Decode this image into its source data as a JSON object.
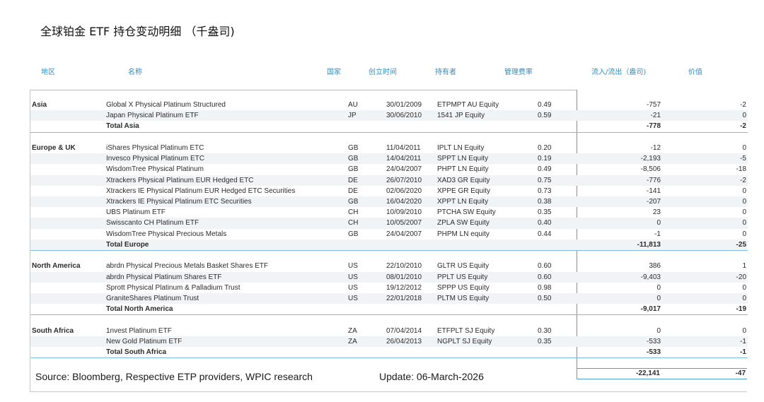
{
  "title": "全球铂金 ETF 持仓变动明细 （千盎司)",
  "headers": {
    "region": "地区",
    "name": "名称",
    "country": "国家",
    "date": "创立时间",
    "holder": "持有者",
    "fee": "管理费率",
    "flow": "流入/流出（盎司)",
    "value": "价值"
  },
  "sections": [
    {
      "region": "Asia",
      "rows": [
        {
          "name": "Global X Physical Platinum Structured",
          "country": "AU",
          "date": "30/01/2009",
          "holder": "ETPMPT AU Equity",
          "fee": "0.49",
          "flow": "-757",
          "value": "-2"
        },
        {
          "name": "Japan Physical Platinum ETF",
          "country": "JP",
          "date": "30/06/2010",
          "holder": "1541 JP Equity",
          "fee": "0.59",
          "flow": "-21",
          "value": "0"
        }
      ],
      "total": {
        "label": "Total Asia",
        "flow": "-778",
        "value": "-2"
      }
    },
    {
      "region": "Europe & UK",
      "rows": [
        {
          "name": "iShares Physical Platinum ETC",
          "country": "GB",
          "date": "11/04/2011",
          "holder": "IPLT LN Equity",
          "fee": "0.20",
          "flow": "-12",
          "value": "0"
        },
        {
          "name": "Invesco Physical Platinum ETC",
          "country": "GB",
          "date": "14/04/2011",
          "holder": "SPPT LN Equity",
          "fee": "0.19",
          "flow": "-2,193",
          "value": "-5"
        },
        {
          "name": "WisdomTree Physical Platinum",
          "country": "GB",
          "date": "24/04/2007",
          "holder": "PHPT LN Equity",
          "fee": "0.49",
          "flow": "-8,506",
          "value": "-18"
        },
        {
          "name": "Xtrackers Physical Platinum EUR Hedged ETC",
          "country": "DE",
          "date": "26/07/2010",
          "holder": "XAD3 GR Equity",
          "fee": "0.75",
          "flow": "-776",
          "value": "-2"
        },
        {
          "name": "Xtrackers IE Physical Platinum EUR Hedged ETC Securities",
          "country": "DE",
          "date": "02/06/2020",
          "holder": "XPPE GR Equity",
          "fee": "0.73",
          "flow": "-141",
          "value": "0"
        },
        {
          "name": "Xtrackers IE Physical Platinum ETC Securities",
          "country": "GB",
          "date": "16/04/2020",
          "holder": "XPPT LN Equity",
          "fee": "0.38",
          "flow": "-207",
          "value": "0"
        },
        {
          "name": "UBS Platinum ETF",
          "country": "CH",
          "date": "10/09/2010",
          "holder": "PTCHA SW Equity",
          "fee": "0.35",
          "flow": "23",
          "value": "0"
        },
        {
          "name": "Swisscanto CH Platinum ETF",
          "country": "CH",
          "date": "10/05/2007",
          "holder": "ZPLA SW Equity",
          "fee": "0.40",
          "flow": "0",
          "value": "0"
        },
        {
          "name": "WisdomTree Physical Precious Metals",
          "country": "GB",
          "date": "24/04/2007",
          "holder": "PHPM LN equity",
          "fee": "0.44",
          "flow": "-1",
          "value": "0"
        }
      ],
      "total": {
        "label": "Total Europe",
        "flow": "-11,813",
        "value": "-25"
      }
    },
    {
      "region": "North America",
      "rows": [
        {
          "name": "abrdn Physical Precious Metals Basket Shares ETF",
          "country": "US",
          "date": "22/10/2010",
          "holder": "GLTR US Equity",
          "fee": "0.60",
          "flow": "386",
          "value": "1"
        },
        {
          "name": "abrdn Physical Platinum Shares ETF",
          "country": "US",
          "date": "08/01/2010",
          "holder": "PPLT US Equity",
          "fee": "0.60",
          "flow": "-9,403",
          "value": "-20"
        },
        {
          "name": "Sprott Physical Platinum & Palladium Trust",
          "country": "US",
          "date": "19/12/2012",
          "holder": "SPPP US Equity",
          "fee": "0.98",
          "flow": "0",
          "value": "0"
        },
        {
          "name": "GraniteShares Platinum Trust",
          "country": "US",
          "date": "22/01/2018",
          "holder": "PLTM US Equity",
          "fee": "0.50",
          "flow": "0",
          "value": "0"
        }
      ],
      "total": {
        "label": "Total North America",
        "flow": "-9,017",
        "value": "-19"
      }
    },
    {
      "region": "South Africa",
      "rows": [
        {
          "name": "1nvest Platinum ETF",
          "country": "ZA",
          "date": "07/04/2014",
          "holder": "ETFPLT SJ Equity",
          "fee": "0.30",
          "flow": "0",
          "value": "0"
        },
        {
          "name": "New Gold Platinum ETF",
          "country": "ZA",
          "date": "26/04/2013",
          "holder": "NGPLT SJ Equity",
          "fee": "0.35",
          "flow": "-533",
          "value": "-1"
        }
      ],
      "total": {
        "label": "Total South Africa",
        "flow": "-533",
        "value": "-1"
      }
    }
  ],
  "grand_total": {
    "flow": "-22,141",
    "value": "-47"
  },
  "footer": {
    "source": "Source: Bloomberg,  Respective  ETP providers,  WPIC research",
    "update": "Update:  06-March-2026"
  }
}
